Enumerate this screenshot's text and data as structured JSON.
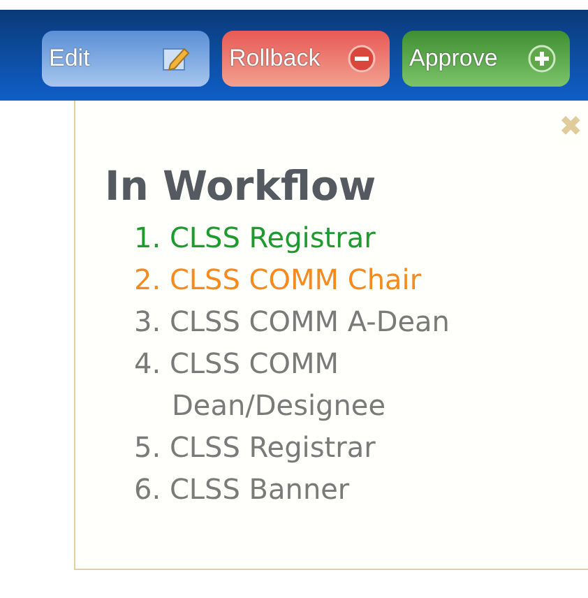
{
  "toolbar": {
    "buttons": [
      {
        "kind": "edit",
        "label": "Edit"
      },
      {
        "kind": "rollback",
        "label": "Rollback"
      },
      {
        "kind": "approve",
        "label": "Approve"
      }
    ]
  },
  "panel": {
    "close": "✖",
    "title": "In Workflow",
    "steps": [
      {
        "label": "1. CLSS Registrar",
        "color": "#1e9a2e"
      },
      {
        "label": "2. CLSS COMM Chair",
        "color": "#f58a1f"
      },
      {
        "label": "3. CLSS COMM A-Dean",
        "color": "#7a7a7a"
      },
      {
        "label": "4. CLSS COMM Dean/Designee",
        "color": "#7a7a7a"
      },
      {
        "label": "5. CLSS Registrar",
        "color": "#7a7a7a"
      },
      {
        "label": "6. CLSS Banner",
        "color": "#7a7a7a"
      }
    ]
  }
}
